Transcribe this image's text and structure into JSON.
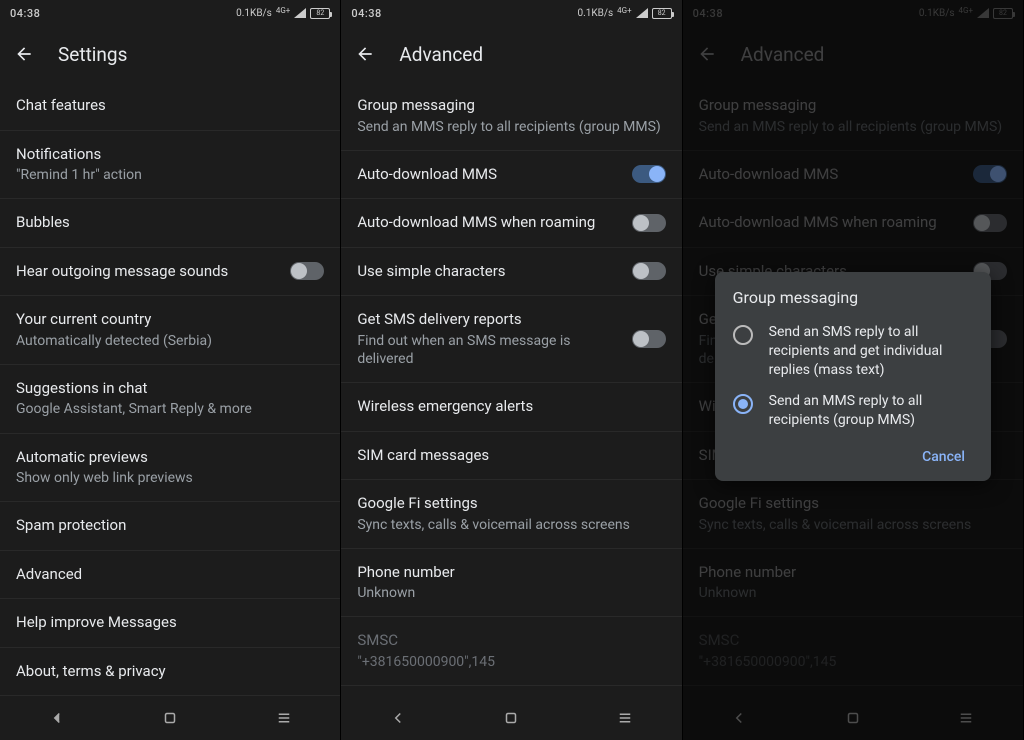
{
  "status": {
    "time": "04:38",
    "speed": "0.1KB/s",
    "net": "4G+",
    "battery": "82"
  },
  "pane1": {
    "title": "Settings",
    "items": [
      {
        "title": "Chat features",
        "sub": ""
      },
      {
        "title": "Notifications",
        "sub": "\"Remind 1 hr\" action"
      },
      {
        "title": "Bubbles",
        "sub": ""
      },
      {
        "title": "Hear outgoing message sounds",
        "sub": ""
      },
      {
        "title": "Your current country",
        "sub": "Automatically detected (Serbia)"
      },
      {
        "title": "Suggestions in chat",
        "sub": "Google Assistant, Smart Reply & more"
      },
      {
        "title": "Automatic previews",
        "sub": "Show only web link previews"
      },
      {
        "title": "Spam protection",
        "sub": ""
      },
      {
        "title": "Advanced",
        "sub": ""
      },
      {
        "title": "Help improve Messages",
        "sub": ""
      },
      {
        "title": "About, terms & privacy",
        "sub": ""
      }
    ]
  },
  "pane2": {
    "title": "Advanced",
    "items": [
      {
        "title": "Group messaging",
        "sub": "Send an MMS reply to all recipients (group MMS)"
      },
      {
        "title": "Auto-download MMS",
        "sub": ""
      },
      {
        "title": "Auto-download MMS when roaming",
        "sub": ""
      },
      {
        "title": "Use simple characters",
        "sub": ""
      },
      {
        "title": "Get SMS delivery reports",
        "sub": "Find out when an SMS message is delivered"
      },
      {
        "title": "Wireless emergency alerts",
        "sub": ""
      },
      {
        "title": "SIM card messages",
        "sub": ""
      },
      {
        "title": "Google Fi settings",
        "sub": "Sync texts, calls & voicemail across screens"
      },
      {
        "title": "Phone number",
        "sub": "Unknown"
      },
      {
        "title": "SMSC",
        "sub": "\"+381650000900\",145"
      }
    ]
  },
  "pane3": {
    "title": "Advanced",
    "items": [
      {
        "title": "Group messaging",
        "sub": "Send an MMS reply to all recipients (group MMS)"
      },
      {
        "title": "Auto-download MMS",
        "sub": ""
      },
      {
        "title": "Auto-download MMS when roaming",
        "sub": ""
      },
      {
        "title": "Use simple characters",
        "sub": ""
      },
      {
        "title": "Get SMS delivery reports",
        "sub": "Find out when an SMS message is delivered"
      },
      {
        "title": "Wireless emergency alerts",
        "sub": ""
      },
      {
        "title": "SIM card messages",
        "sub": ""
      },
      {
        "title": "Google Fi settings",
        "sub": "Sync texts, calls & voicemail across screens"
      },
      {
        "title": "Phone number",
        "sub": "Unknown"
      },
      {
        "title": "SMSC",
        "sub": "\"+381650000900\",145"
      }
    ],
    "dialog": {
      "title": "Group messaging",
      "options": [
        "Send an SMS reply to all recipients and get individual replies (mass text)",
        "Send an MMS reply to all recipients (group MMS)"
      ],
      "cancel": "Cancel"
    }
  }
}
